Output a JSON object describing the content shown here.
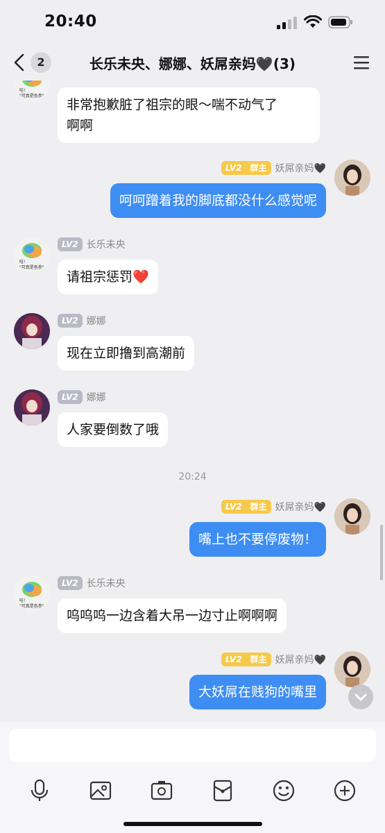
{
  "status_bar": {
    "time": "20:40"
  },
  "header": {
    "unread_count": "2",
    "title": "长乐未央、娜娜、妖屌亲妈🖤(3)"
  },
  "messages": [
    {
      "sender": "长乐未央",
      "direction": "in",
      "text": "非常抱歉脏了祖宗的眼～喘不动气了啊啊"
    },
    {
      "sender": "妖屌亲妈🖤",
      "level": "LV2",
      "role": "群主",
      "direction": "out",
      "text": "呵呵蹭着我的脚底都没什么感觉呢"
    },
    {
      "sender": "长乐未央",
      "level": "LV2",
      "direction": "in",
      "text": "请祖宗惩罚❤️"
    },
    {
      "sender": "娜娜",
      "level": "LV2",
      "direction": "in",
      "text": "现在立即撸到高潮前"
    },
    {
      "sender": "娜娜",
      "level": "LV2",
      "direction": "in",
      "text": "人家要倒数了哦"
    },
    {
      "timestamp": "20:24"
    },
    {
      "sender": "妖屌亲妈🖤",
      "level": "LV2",
      "role": "群主",
      "direction": "out",
      "text": "嘴上也不要停废物！"
    },
    {
      "sender": "长乐未央",
      "level": "LV2",
      "direction": "in",
      "text": "呜呜呜一边含着大吊一边寸止啊啊啊"
    },
    {
      "sender": "妖屌亲妈🖤",
      "level": "LV2",
      "role": "群主",
      "direction": "out",
      "text": "大妖屌在贱狗的嘴里"
    }
  ],
  "bubble_lines": {
    "m0_l1": "非常抱歉脏了祖宗的眼～喘不动气了",
    "m0_l2": "啊啊"
  },
  "level_badge": "LV2",
  "colors": {
    "outgoing_bubble": "#3e8df3",
    "incoming_bubble": "#ffffff",
    "owner_badge": "#f6c94a",
    "level_badge": "#b9bac6",
    "background": "#efeff1"
  },
  "toolbar_icons": [
    "microphone-icon",
    "image-icon",
    "camera-icon",
    "red-packet-icon",
    "emoji-icon",
    "plus-icon"
  ]
}
